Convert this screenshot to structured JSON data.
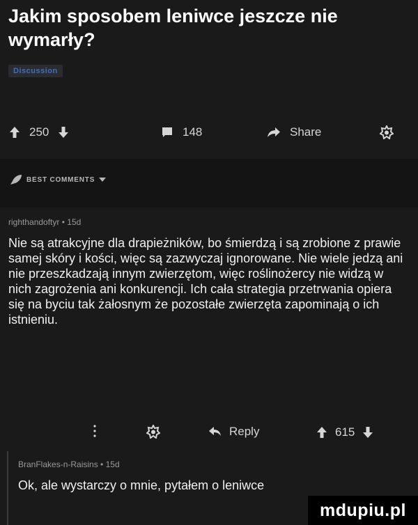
{
  "post": {
    "title": "Jakim sposobem leniwce jeszcze nie wymarły?",
    "flair": "Discussion"
  },
  "actions": {
    "score": "250",
    "comments": "148",
    "share_label": "Share"
  },
  "best_comments_label": "BEST COMMENTS",
  "comments": [
    {
      "author": "righthandoftyr",
      "age": "15d",
      "text": "Nie są atrakcyjne dla drapieżników, bo śmierdzą i są zrobione z prawie samej skóry i kości, więc są zazwyczaj ignorowane. Nie wiele jedzą ani nie przeszkadzają innym zwierzętom, więc roślinożercy nie widzą w nich zagrożenia ani konkurencji. Ich cała strategia przetrwania opiera się na byciu tak żałosnym że pozostałe zwierzęta zapominają o ich istnieniu.",
      "reply_label": "Reply",
      "score": "615"
    },
    {
      "author": "BranFlakes-n-Raisins",
      "age": "15d",
      "text": "Ok, ale wystarczy o mnie, pytałem o leniwce"
    }
  ],
  "meta_separator": "•",
  "watermark": "mdupiu.pl",
  "colors": {
    "background": "#1a1a1b",
    "best_bar": "#141415",
    "flair_text": "#3f6fbf"
  },
  "icons": [
    "upvote-icon",
    "downvote-icon",
    "comment-icon",
    "share-icon",
    "award-icon",
    "rocket-icon",
    "chevron-down-icon",
    "more-icon",
    "reply-icon"
  ]
}
